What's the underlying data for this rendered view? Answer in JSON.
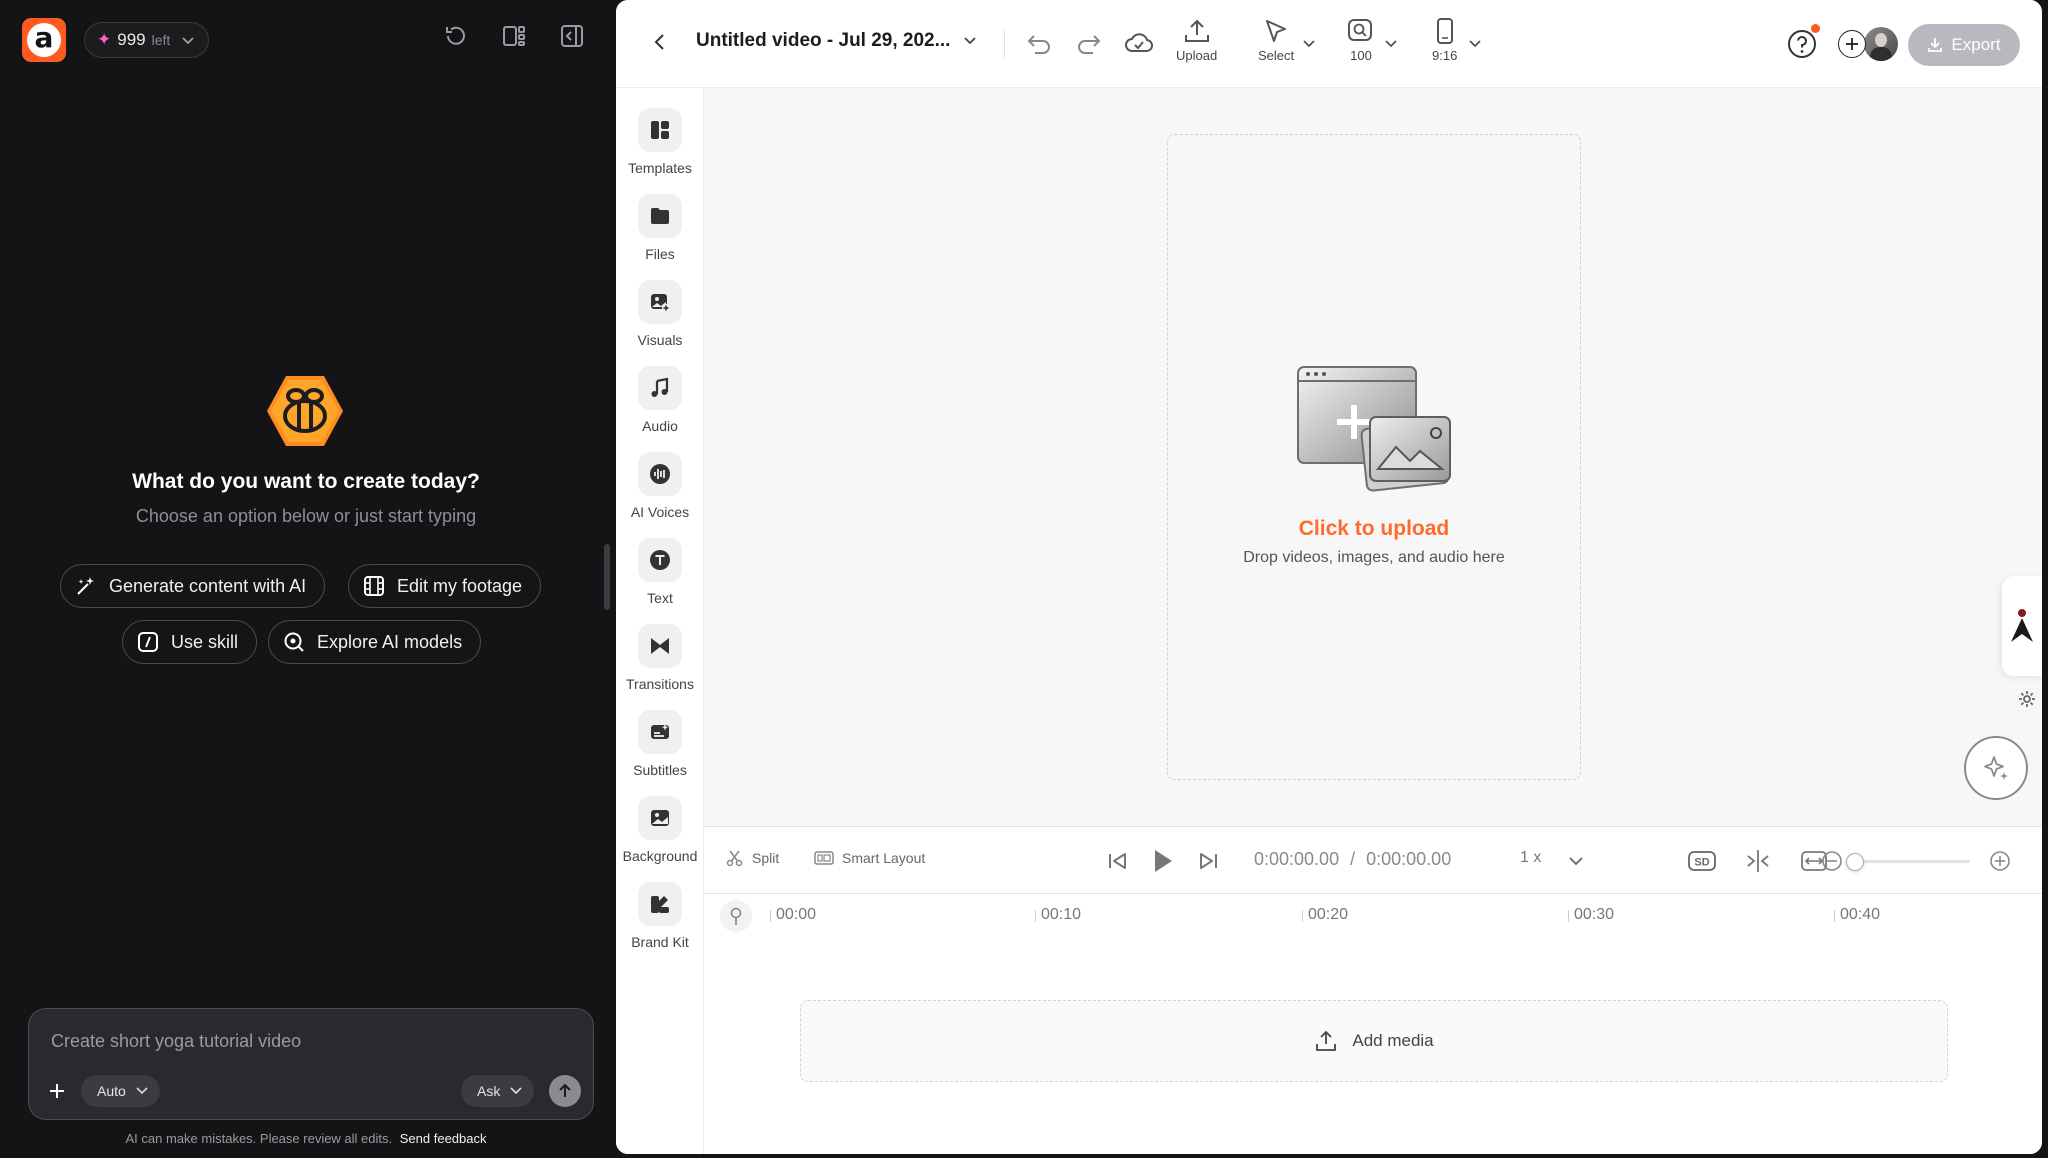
{
  "assistant": {
    "credits_count": "999",
    "credits_suffix": "left",
    "hero_title": "What do you want to create today?",
    "hero_subtitle": "Choose an option below or just start typing",
    "chips": {
      "generate": "Generate content with AI",
      "footage": "Edit my footage",
      "skill": "Use skill",
      "models": "Explore AI models"
    },
    "prompt_placeholder": "Create short yoga tutorial video",
    "mode_label": "Auto",
    "ask_label": "Ask",
    "disclaimer": "AI can make mistakes. Please review all edits.",
    "feedback_link": "Send feedback"
  },
  "editor": {
    "project_title": "Untitled video - Jul 29, 202...",
    "tools": {
      "upload": "Upload",
      "select": "Select",
      "zoom": "100",
      "aspect": "9:16"
    },
    "export_label": "Export",
    "sidebar": [
      {
        "label": "Templates",
        "icon": "templates-icon"
      },
      {
        "label": "Files",
        "icon": "folder-icon"
      },
      {
        "label": "Visuals",
        "icon": "image-plus-icon"
      },
      {
        "label": "Audio",
        "icon": "music-note-icon"
      },
      {
        "label": "AI Voices",
        "icon": "waveform-icon"
      },
      {
        "label": "Text",
        "icon": "text-icon"
      },
      {
        "label": "Transitions",
        "icon": "bowtie-icon"
      },
      {
        "label": "Subtitles",
        "icon": "subtitles-icon"
      },
      {
        "label": "Background",
        "icon": "image-icon"
      },
      {
        "label": "Brand Kit",
        "icon": "brand-kit-icon"
      }
    ],
    "upload_title": "Click to upload",
    "upload_subtitle": "Drop videos, images, and audio here",
    "controls": {
      "split": "Split",
      "smart_layout": "Smart Layout",
      "time_current": "0:00:00.00",
      "time_separator": "/",
      "time_total": "0:00:00.00",
      "speed": "1 x",
      "quality": "SD"
    },
    "timeline_ticks": [
      "00:00",
      "00:10",
      "00:20",
      "00:30",
      "00:40"
    ],
    "add_media": "Add media"
  },
  "colors": {
    "accent": "#ff5a1f",
    "upload_text": "#ff6b2c",
    "panel_bg": "#141416",
    "export_disabled": "#b8b8be"
  }
}
